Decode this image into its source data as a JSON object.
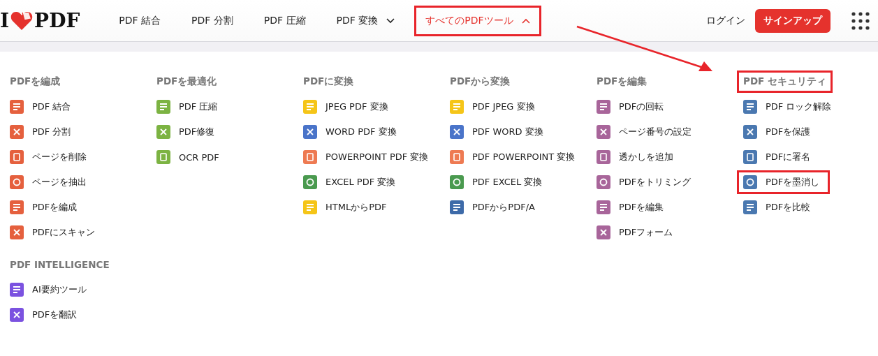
{
  "header": {
    "logo": {
      "left": "I",
      "right": "PDF"
    },
    "nav": [
      {
        "label": "PDF 結合",
        "selected": false,
        "dropdown": false,
        "highlighted": false
      },
      {
        "label": "PDF 分割",
        "selected": false,
        "dropdown": false,
        "highlighted": false
      },
      {
        "label": "PDF 圧縮",
        "selected": false,
        "dropdown": false,
        "highlighted": false
      },
      {
        "label": "PDF 変換",
        "selected": false,
        "dropdown": true,
        "expanded": false,
        "highlighted": false
      },
      {
        "label": "すべてのPDFツール",
        "selected": true,
        "dropdown": true,
        "expanded": true,
        "highlighted": true
      }
    ],
    "login": "ログイン",
    "signup": "サインアップ"
  },
  "menu": {
    "columns": [
      {
        "sections": [
          {
            "title": "PDFを編成",
            "highlighted": false,
            "items": [
              {
                "label": "PDF 結合",
                "color": "#e5603e",
                "highlighted": false
              },
              {
                "label": "PDF 分割",
                "color": "#e5603e",
                "highlighted": false
              },
              {
                "label": "ページを削除",
                "color": "#e5603e",
                "highlighted": false
              },
              {
                "label": "ページを抽出",
                "color": "#e5603e",
                "highlighted": false
              },
              {
                "label": "PDFを編成",
                "color": "#e5603e",
                "highlighted": false
              },
              {
                "label": "PDFにスキャン",
                "color": "#e5603e",
                "highlighted": false
              }
            ]
          },
          {
            "title": "PDF INTELLIGENCE",
            "highlighted": false,
            "items": [
              {
                "label": "AI要約ツール",
                "color": "#7b52e0",
                "highlighted": false
              },
              {
                "label": "PDFを翻訳",
                "color": "#7b52e0",
                "highlighted": false
              }
            ]
          }
        ]
      },
      {
        "sections": [
          {
            "title": "PDFを最適化",
            "highlighted": false,
            "items": [
              {
                "label": "PDF 圧縮",
                "color": "#7cb342",
                "highlighted": false
              },
              {
                "label": "PDF修復",
                "color": "#7cb342",
                "highlighted": false
              },
              {
                "label": "OCR PDF",
                "color": "#7cb342",
                "highlighted": false
              }
            ]
          }
        ]
      },
      {
        "sections": [
          {
            "title": "PDFに変換",
            "highlighted": false,
            "items": [
              {
                "label": "JPEG PDF 変換",
                "color": "#f5c518",
                "highlighted": false
              },
              {
                "label": "WORD PDF 変換",
                "color": "#4a74c9",
                "highlighted": false
              },
              {
                "label": "POWERPOINT PDF 変換",
                "color": "#ee7a52",
                "highlighted": false
              },
              {
                "label": "EXCEL PDF 変換",
                "color": "#4a9a4f",
                "highlighted": false
              },
              {
                "label": "HTMLからPDF",
                "color": "#f5c518",
                "highlighted": false
              }
            ]
          }
        ]
      },
      {
        "sections": [
          {
            "title": "PDFから変換",
            "highlighted": false,
            "items": [
              {
                "label": "PDF JPEG 変換",
                "color": "#f5c518",
                "highlighted": false
              },
              {
                "label": "PDF WORD 変換",
                "color": "#4a74c9",
                "highlighted": false
              },
              {
                "label": "PDF POWERPOINT 変換",
                "color": "#ee7a52",
                "highlighted": false
              },
              {
                "label": "PDF EXCEL 変換",
                "color": "#4a9a4f",
                "highlighted": false
              },
              {
                "label": "PDFからPDF/A",
                "color": "#3d6aa8",
                "highlighted": false
              }
            ]
          }
        ]
      },
      {
        "sections": [
          {
            "title": "PDFを編集",
            "highlighted": false,
            "items": [
              {
                "label": "PDFの回転",
                "color": "#a8659a",
                "highlighted": false
              },
              {
                "label": "ページ番号の設定",
                "color": "#a8659a",
                "highlighted": false
              },
              {
                "label": "透かしを追加",
                "color": "#a8659a",
                "highlighted": false
              },
              {
                "label": "PDFをトリミング",
                "color": "#a8659a",
                "highlighted": false
              },
              {
                "label": "PDFを編集",
                "color": "#a8659a",
                "highlighted": false
              },
              {
                "label": "PDFフォーム",
                "color": "#a8659a",
                "highlighted": false
              }
            ]
          }
        ]
      },
      {
        "sections": [
          {
            "title": "PDF セキュリティ",
            "highlighted": true,
            "items": [
              {
                "label": "PDF ロック解除",
                "color": "#4a78b0",
                "highlighted": false
              },
              {
                "label": "PDFを保護",
                "color": "#4a78b0",
                "highlighted": false
              },
              {
                "label": "PDFに署名",
                "color": "#4a78b0",
                "highlighted": false
              },
              {
                "label": "PDFを墨消し",
                "color": "#4a78b0",
                "highlighted": true
              },
              {
                "label": "PDFを比較",
                "color": "#4a78b0",
                "highlighted": false
              }
            ]
          }
        ]
      }
    ]
  }
}
